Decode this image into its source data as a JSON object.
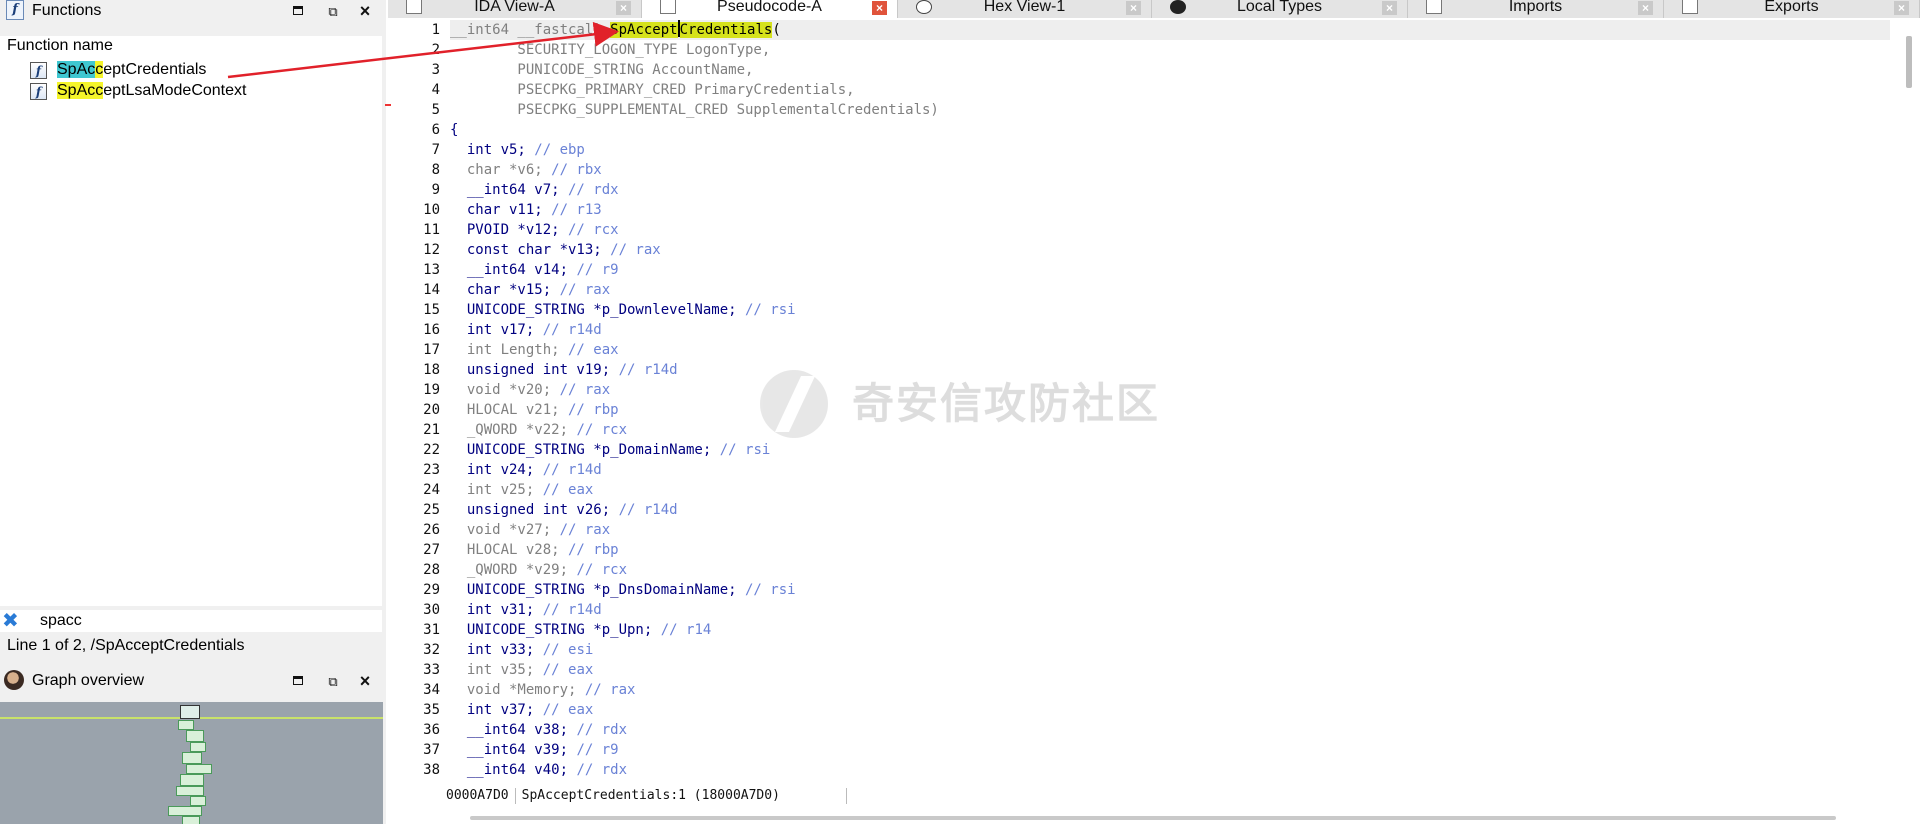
{
  "functions_panel": {
    "title": "Functions",
    "column_header": "Function name",
    "items": [
      {
        "prefix": "SpAc",
        "match": "c",
        "rest": "eptCredentials",
        "selected": true
      },
      {
        "prefix": "SpAc",
        "match": "c",
        "rest": "eptLsaModeContext",
        "selected": false
      }
    ],
    "filter_text": "spacc",
    "status": "Line 1 of 2, /SpAcceptCredentials"
  },
  "graph_panel": {
    "title": "Graph overview"
  },
  "tabs": [
    {
      "label": "IDA View-A",
      "active": false
    },
    {
      "label": "Pseudocode-A",
      "active": true
    },
    {
      "label": "Hex View-1",
      "active": false
    },
    {
      "label": "Local Types",
      "active": false
    },
    {
      "label": "Imports",
      "active": false
    },
    {
      "label": "Exports",
      "active": false
    }
  ],
  "code": {
    "line_numbers": [
      "1",
      "2",
      "3",
      "4",
      "5",
      "6",
      "7",
      "8",
      "9",
      "10",
      "11",
      "12",
      "13",
      "14",
      "15",
      "16",
      "17",
      "18",
      "19",
      "20",
      "21",
      "22",
      "23",
      "24",
      "25",
      "26",
      "27",
      "28",
      "29",
      "30",
      "31",
      "32",
      "33",
      "34",
      "35",
      "36",
      "37",
      "38"
    ],
    "signature": {
      "return_type": "__int64 __fastcall ",
      "func_name_hl": "SpAccept",
      "func_name_rest": "Credentials",
      "paren": "("
    },
    "params": [
      "        SECURITY_LOGON_TYPE LogonType,",
      "        PUNICODE_STRING AccountName,",
      "        PSECPKG_PRIMARY_CRED PrimaryCredentials,",
      "        PSECPKG_SUPPLEMENTAL_CRED SupplementalCredentials)"
    ],
    "open_brace": "{",
    "decls": [
      {
        "decl": "  int v5;",
        "comment": " // ebp",
        "used": true
      },
      {
        "decl": "  char *v6;",
        "comment": " // rbx",
        "used": false
      },
      {
        "decl": "  __int64 v7;",
        "comment": " // rdx",
        "used": true
      },
      {
        "decl": "  char v11;",
        "comment": " // r13",
        "used": true
      },
      {
        "decl": "  PVOID *v12;",
        "comment": " // rcx",
        "used": true
      },
      {
        "decl": "  const char *v13;",
        "comment": " // rax",
        "used": true
      },
      {
        "decl": "  __int64 v14;",
        "comment": " // r9",
        "used": true
      },
      {
        "decl": "  char *v15;",
        "comment": " // rax",
        "used": true
      },
      {
        "decl": "  UNICODE_STRING *p_DownlevelName;",
        "comment": " // rsi",
        "used": true
      },
      {
        "decl": "  int v17;",
        "comment": " // r14d",
        "used": true
      },
      {
        "decl": "  int Length;",
        "comment": " // eax",
        "used": false
      },
      {
        "decl": "  unsigned int v19;",
        "comment": " // r14d",
        "used": true
      },
      {
        "decl": "  void *v20;",
        "comment": " // rax",
        "used": false
      },
      {
        "decl": "  HLOCAL v21;",
        "comment": " // rbp",
        "used": false
      },
      {
        "decl": "  _QWORD *v22;",
        "comment": " // rcx",
        "used": false
      },
      {
        "decl": "  UNICODE_STRING *p_DomainName;",
        "comment": " // rsi",
        "used": true
      },
      {
        "decl": "  int v24;",
        "comment": " // r14d",
        "used": true
      },
      {
        "decl": "  int v25;",
        "comment": " // eax",
        "used": false
      },
      {
        "decl": "  unsigned int v26;",
        "comment": " // r14d",
        "used": true
      },
      {
        "decl": "  void *v27;",
        "comment": " // rax",
        "used": false
      },
      {
        "decl": "  HLOCAL v28;",
        "comment": " // rbp",
        "used": false
      },
      {
        "decl": "  _QWORD *v29;",
        "comment": " // rcx",
        "used": false
      },
      {
        "decl": "  UNICODE_STRING *p_DnsDomainName;",
        "comment": " // rsi",
        "used": true
      },
      {
        "decl": "  int v31;",
        "comment": " // r14d",
        "used": true
      },
      {
        "decl": "  UNICODE_STRING *p_Upn;",
        "comment": " // r14",
        "used": true
      },
      {
        "decl": "  int v33;",
        "comment": " // esi",
        "used": true
      },
      {
        "decl": "  int v35;",
        "comment": " // eax",
        "used": false
      },
      {
        "decl": "  void *Memory;",
        "comment": " // rax",
        "used": false
      },
      {
        "decl": "  int v37;",
        "comment": " // eax",
        "used": true
      },
      {
        "decl": "  __int64 v38;",
        "comment": " // rdx",
        "used": true
      },
      {
        "decl": "  __int64 v39;",
        "comment": " // r9",
        "used": true
      },
      {
        "decl": "  __int64 v40;",
        "comment": " // rdx",
        "used": true
      }
    ],
    "status_address": "0000A7D0",
    "status_location": "SpAcceptCredentials:1 (18000A7D0)"
  },
  "watermark": "奇安信攻防社区",
  "colors": {
    "match_cyan": "#3fc7d1",
    "match_yellow": "#f5f52a",
    "annotation_red": "#e1212a",
    "type_blue": "#000080",
    "comment_blue": "#6a82d6"
  }
}
